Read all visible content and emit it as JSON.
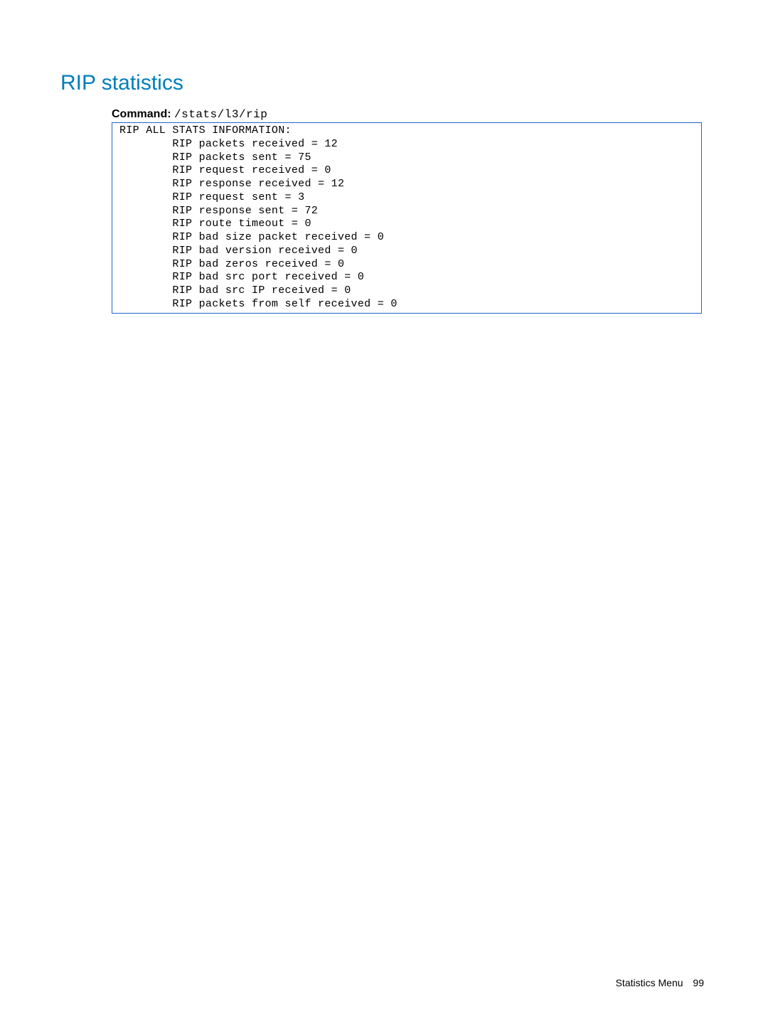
{
  "title": "RIP statistics",
  "command": {
    "label": "Command:",
    "path": "/stats/l3/rip"
  },
  "output": {
    "header": "RIP ALL STATS INFORMATION:",
    "stats": [
      {
        "label": "RIP packets received",
        "value": 12
      },
      {
        "label": "RIP packets sent",
        "value": 75
      },
      {
        "label": "RIP request received",
        "value": 0
      },
      {
        "label": "RIP response received",
        "value": 12
      },
      {
        "label": "RIP request sent",
        "value": 3
      },
      {
        "label": "RIP response sent",
        "value": 72
      },
      {
        "label": "RIP route timeout",
        "value": 0
      },
      {
        "label": "RIP bad size packet received",
        "value": 0
      },
      {
        "label": "RIP bad version received",
        "value": 0
      },
      {
        "label": "RIP bad zeros received",
        "value": 0
      },
      {
        "label": "RIP bad src port received",
        "value": 0
      },
      {
        "label": "RIP bad src IP received",
        "value": 0
      },
      {
        "label": "RIP packets from self received",
        "value": 0
      }
    ]
  },
  "footer": {
    "section": "Statistics Menu",
    "page": "99"
  }
}
